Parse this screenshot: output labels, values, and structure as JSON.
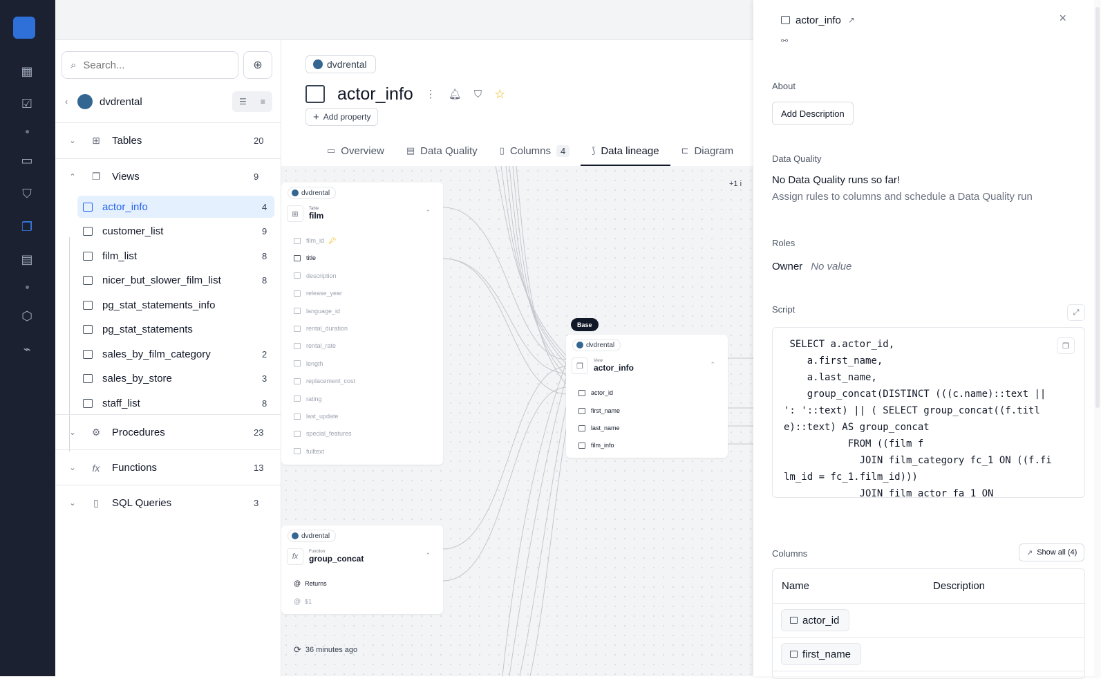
{
  "search": {
    "placeholder": "Search..."
  },
  "sidebar": {
    "source_name": "dvdrental",
    "sections": [
      {
        "label": "Tables",
        "count": "20"
      },
      {
        "label": "Views",
        "count": "9"
      },
      {
        "label": "Procedures",
        "count": "23"
      },
      {
        "label": "Functions",
        "count": "13"
      },
      {
        "label": "SQL Queries",
        "count": "3"
      }
    ],
    "views": [
      {
        "label": "actor_info",
        "count": "4"
      },
      {
        "label": "customer_list",
        "count": "9"
      },
      {
        "label": "film_list",
        "count": "8"
      },
      {
        "label": "nicer_but_slower_film_list",
        "count": "8"
      },
      {
        "label": "pg_stat_statements_info",
        "count": ""
      },
      {
        "label": "pg_stat_statements",
        "count": ""
      },
      {
        "label": "sales_by_film_category",
        "count": "2"
      },
      {
        "label": "sales_by_store",
        "count": "3"
      },
      {
        "label": "staff_list",
        "count": "8"
      }
    ]
  },
  "main": {
    "source": "dvdrental",
    "title": "actor_info",
    "add_property": "Add property",
    "tabs": [
      {
        "label": "Overview"
      },
      {
        "label": "Data Quality"
      },
      {
        "label": "Columns",
        "badge": "4"
      },
      {
        "label": "Data lineage"
      },
      {
        "label": "Diagram"
      }
    ]
  },
  "lineage": {
    "film_node": {
      "source": "dvdrental",
      "kind": "Table",
      "name": "film",
      "fields": [
        "film_id",
        "title",
        "description",
        "release_year",
        "language_id",
        "rental_duration",
        "rental_rate",
        "length",
        "replacement_cost",
        "rating",
        "last_update",
        "special_features",
        "fulltext"
      ]
    },
    "func_node": {
      "source": "dvdrental",
      "kind": "Function",
      "name": "group_concat",
      "fields": [
        "Returns",
        "$1"
      ]
    },
    "base_node": {
      "badge": "Base",
      "source": "dvdrental",
      "kind": "View",
      "name": "actor_info",
      "fields": [
        "actor_id",
        "first_name",
        "last_name",
        "film_info"
      ]
    },
    "more_label": "+1 i",
    "refreshed": "36 minutes ago"
  },
  "panel": {
    "title": "actor_info",
    "about_label": "About",
    "add_description": "Add Description",
    "dq_label": "Data Quality",
    "dq_title": "No Data Quality runs so far!",
    "dq_sub": "Assign rules to columns and schedule a Data Quality run",
    "roles_label": "Roles",
    "owner_label": "Owner",
    "owner_value": "No value",
    "script_label": "Script",
    "script": " SELECT a.actor_id,\n    a.first_name,\n    a.last_name,\n    group_concat(DISTINCT (((c.name)::text || ': '::text) || ( SELECT group_concat((f.title)::text) AS group_concat\n           FROM ((film f\n             JOIN film_category fc_1 ON ((f.film_id = fc_1.film_id)))\n             JOIN film_actor fa_1 ON",
    "columns_label": "Columns",
    "show_all": "Show all (4)",
    "col_name_header": "Name",
    "col_desc_header": "Description",
    "columns": [
      "actor_id",
      "first_name"
    ]
  }
}
